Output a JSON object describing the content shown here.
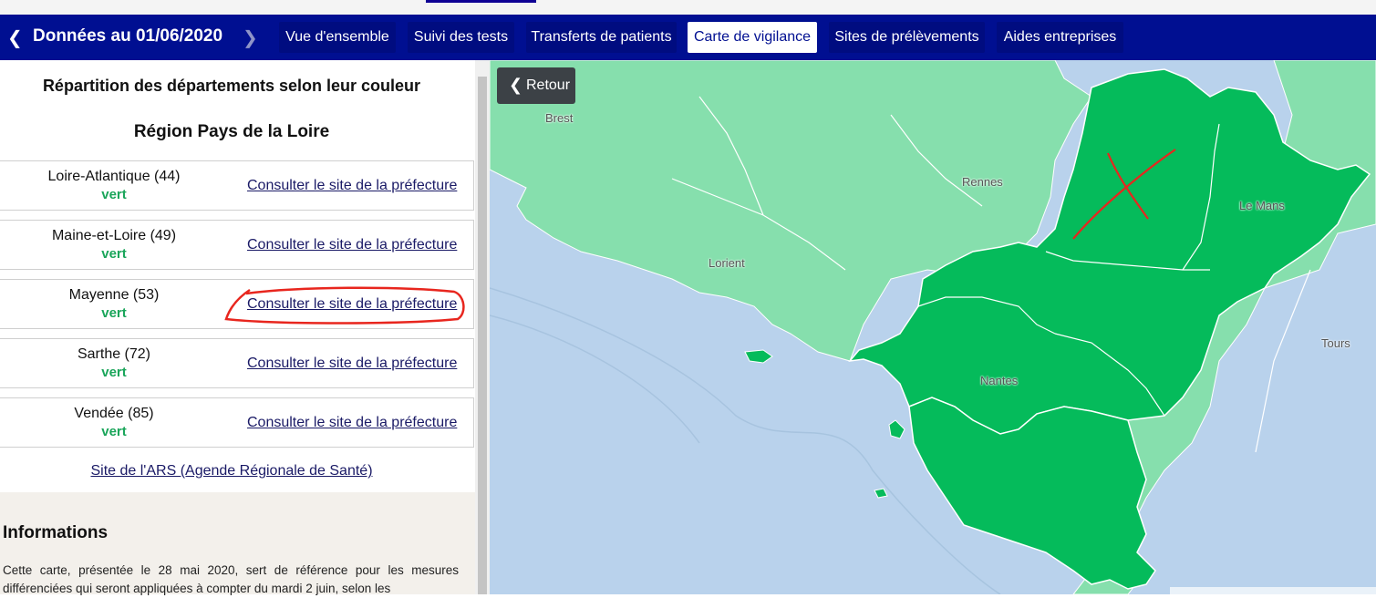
{
  "header": {
    "prev_icon": "chevron-left",
    "date_label": "Données au 01/06/2020",
    "next_icon": "chevron-right",
    "tabs": [
      {
        "label": "Vue d'ensemble"
      },
      {
        "label": "Suivi des tests"
      },
      {
        "label": "Transferts de patients"
      },
      {
        "label": "Carte de vigilance",
        "active": true
      },
      {
        "label": "Sites de prélèvements"
      },
      {
        "label": "Aides entreprises"
      }
    ]
  },
  "panel": {
    "title": "Répartition des départements selon leur couleur",
    "region": "Région Pays de la Loire",
    "departments": [
      {
        "name": "Loire-Atlantique (44)",
        "status": "vert",
        "link": "Consulter le site de la préfecture"
      },
      {
        "name": "Maine-et-Loire (49)",
        "status": "vert",
        "link": "Consulter le site de la préfecture"
      },
      {
        "name": "Mayenne (53)",
        "status": "vert",
        "link": "Consulter le site de la préfecture"
      },
      {
        "name": "Sarthe (72)",
        "status": "vert",
        "link": "Consulter le site de la préfecture"
      },
      {
        "name": "Vendée (85)",
        "status": "vert",
        "link": "Consulter le site de la préfecture"
      }
    ],
    "ars_link": "Site de l'ARS (Agende Régionale de Santé)",
    "info_title": "Informations",
    "info_text": "Cette carte, présentée le 28 mai 2020, sert de référence pour les mesures différenciées qui seront appliquées à compter du mardi 2 juin, selon les"
  },
  "map": {
    "back_button": "Retour",
    "back_icon": "chevron-left",
    "cities": [
      "Brest",
      "Rennes",
      "Le Mans",
      "Lorient",
      "Nantes",
      "Tours"
    ],
    "colors": {
      "region_green": "#05bb5b",
      "other_green": "#86dfad",
      "sea": "#b9d2ec",
      "annotation": "#e8261e"
    }
  }
}
